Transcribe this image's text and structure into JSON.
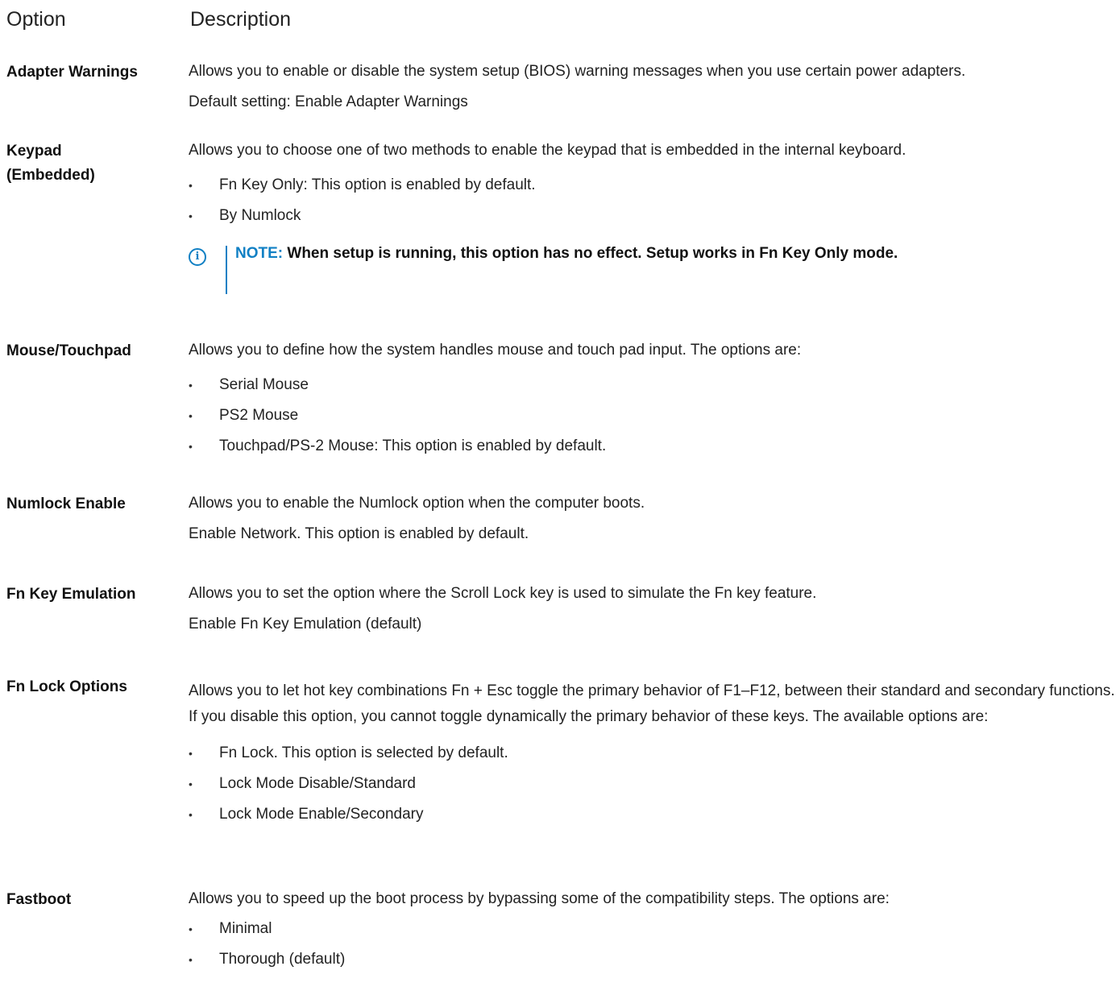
{
  "header": {
    "option": "Option",
    "description": "Description"
  },
  "rows": [
    {
      "name": "Adapter Warnings",
      "desc": "Allows you to enable or disable the system setup (BIOS) warning messages when you use certain power adapters.",
      "extra": "Default setting: Enable Adapter Warnings"
    },
    {
      "name": "Keypad (Embedded)",
      "desc": "Allows you to choose one of two methods to enable the keypad that is embedded in the internal keyboard.",
      "bullets": [
        "Fn Key Only: This option is enabled by default.",
        "By Numlock"
      ],
      "note_label": "NOTE:",
      "note_text": " When setup is running, this option has no effect. Setup works in Fn Key Only mode."
    },
    {
      "name": "Mouse/Touchpad",
      "desc": "Allows you to define how the system handles mouse and touch pad input. The options are:",
      "bullets": [
        "Serial Mouse",
        "PS2 Mouse",
        "Touchpad/PS-2 Mouse: This option is enabled by default."
      ]
    },
    {
      "name": "Numlock Enable",
      "desc": "Allows you to enable the Numlock option when the computer boots.",
      "extra": "Enable Network. This option is enabled by default."
    },
    {
      "name": "Fn Key Emulation",
      "desc": "Allows you to set the option where the Scroll Lock key is used to simulate the Fn key feature.",
      "extra": "Enable Fn Key Emulation (default)"
    },
    {
      "name": "Fn Lock Options",
      "desc": "Allows you to let hot key combinations Fn + Esc toggle the primary behavior of F1–F12, between their standard and secondary functions. If you disable this option, you cannot toggle dynamically the primary behavior of these keys. The available options are:",
      "bullets": [
        "Fn Lock. This option is selected by default.",
        "Lock Mode Disable/Standard",
        "Lock Mode Enable/Secondary"
      ]
    },
    {
      "name": "Fastboot",
      "desc": "Allows you to speed up the boot process by bypassing some of the compatibility steps. The options are:",
      "bullets": [
        "Minimal",
        "Thorough (default)"
      ]
    }
  ]
}
